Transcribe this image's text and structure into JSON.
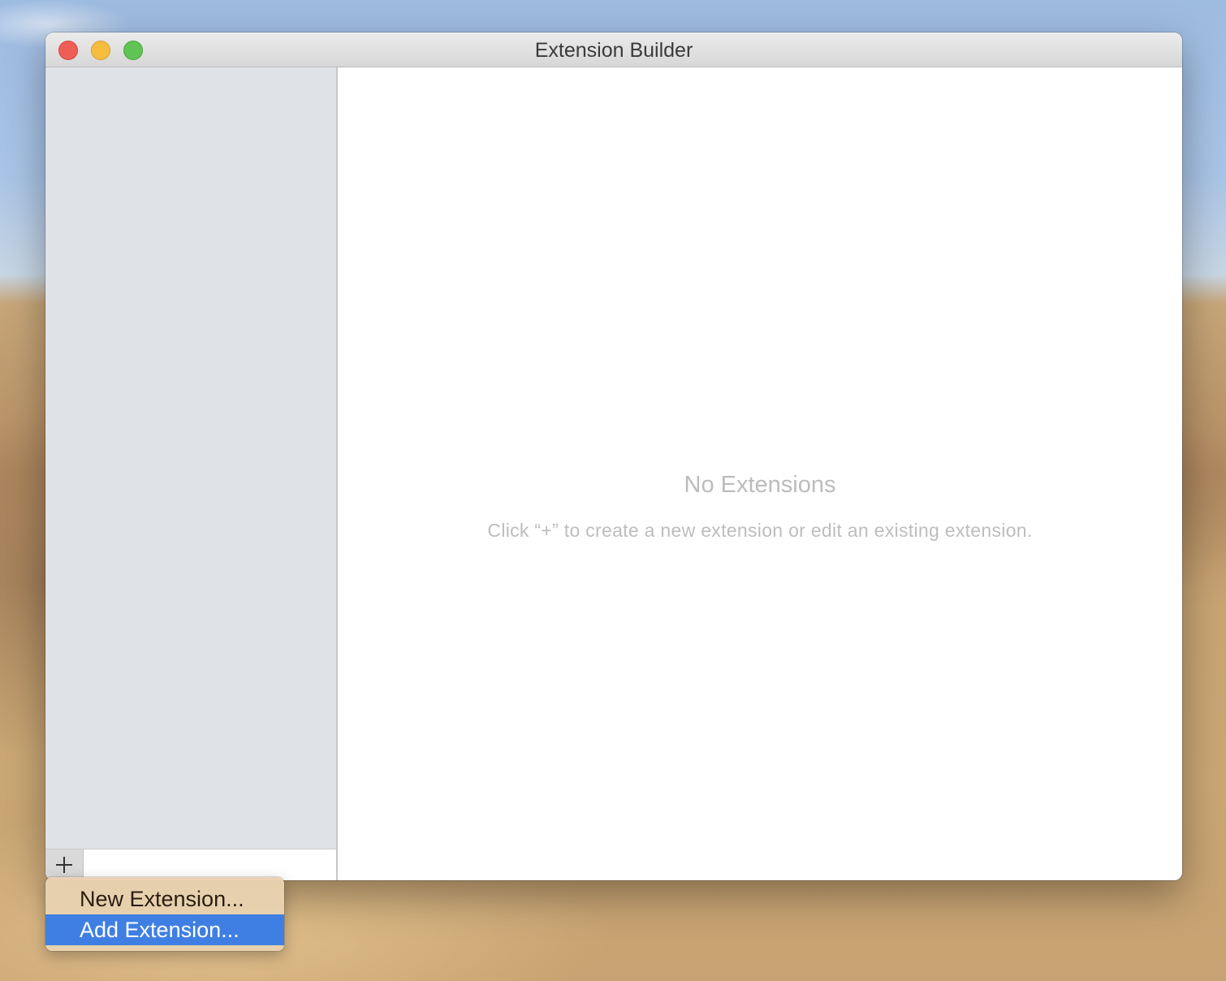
{
  "window": {
    "title": "Extension Builder"
  },
  "sidebar": {
    "add_button_icon": "plus-icon"
  },
  "main": {
    "empty_title": "No Extensions",
    "empty_subtitle": "Click “+” to create a new extension or edit an existing extension."
  },
  "menu": {
    "items": [
      {
        "label": "New Extension...",
        "selected": false
      },
      {
        "label": "Add Extension...",
        "selected": true
      }
    ]
  },
  "colors": {
    "selection": "#3f7fe3",
    "close": "#ee5e57",
    "minimize": "#f6bd3f",
    "zoom": "#5fc453"
  }
}
